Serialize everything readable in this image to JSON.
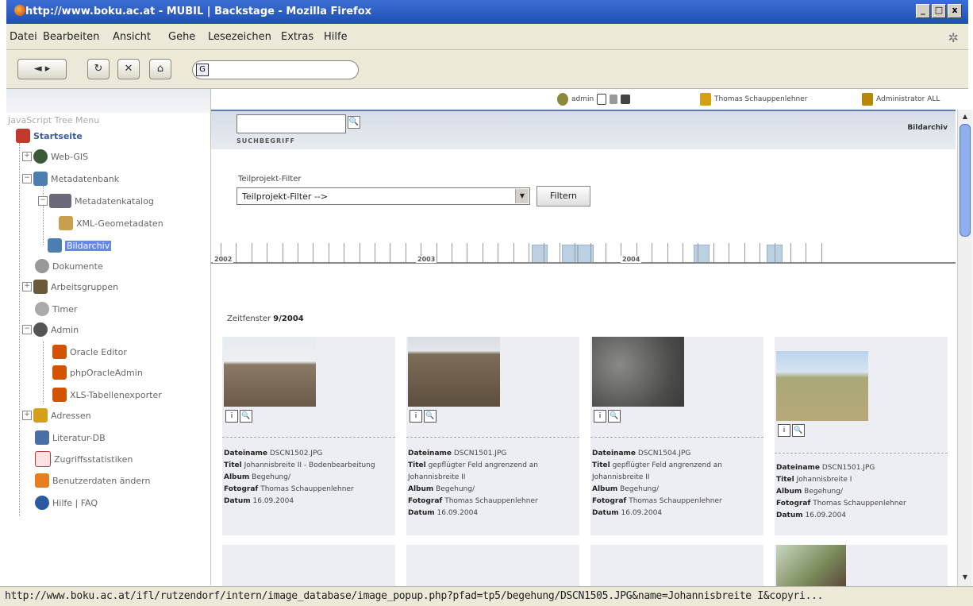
{
  "window": {
    "title": "http://www.boku.ac.at - MUBIL | Backstage - Mozilla Firefox",
    "controls": [
      "_",
      "□",
      "x"
    ]
  },
  "menu": {
    "items": [
      "Datei",
      "Bearbeiten",
      "Ansicht",
      "Gehe",
      "Lesezeichen",
      "Extras",
      "Hilfe"
    ]
  },
  "nav": {
    "back": "◄ ▸",
    "reload": "↻",
    "stop": "✕",
    "home": "⌂",
    "url_icon": "G"
  },
  "sidebar": {
    "title": "JavaScript Tree Menu",
    "items": [
      {
        "label": "Startseite",
        "icon": "home-icon",
        "color": "#c0392b"
      },
      {
        "label": "Web-GIS",
        "icon": "globe-icon",
        "color": "#3a5a3a"
      },
      {
        "label": "Metadatenbank",
        "icon": "database-icon",
        "color": "#4a7fb0"
      },
      {
        "label": "Metadatenkatalog",
        "icon": "catalog-icon",
        "color": "#6a6a7a"
      },
      {
        "label": "XML-Geometadaten",
        "icon": "xml-icon",
        "color": "#c8a050"
      },
      {
        "label": "Bildarchiv",
        "icon": "archive-icon",
        "color": "#4a7fb0"
      },
      {
        "label": "Dokumente",
        "icon": "documents-icon",
        "color": "#777777"
      },
      {
        "label": "Arbeitsgruppen",
        "icon": "group-icon",
        "color": "#6a5a3a"
      },
      {
        "label": "Timer",
        "icon": "timer-icon",
        "color": "#888888"
      },
      {
        "label": "Admin",
        "icon": "admin-icon",
        "color": "#555555"
      },
      {
        "label": "Oracle Editor",
        "icon": "editor-icon",
        "color": "#d35400"
      },
      {
        "label": "phpOracleAdmin",
        "icon": "oracle-admin-icon",
        "color": "#d35400"
      },
      {
        "label": "XLS-Tabellenexporter",
        "icon": "xls-export-icon",
        "color": "#d35400"
      },
      {
        "label": "Adressen",
        "icon": "address-icon",
        "color": "#d4a017"
      },
      {
        "label": "Literatur-DB",
        "icon": "literature-icon",
        "color": "#4a6fa5"
      },
      {
        "label": "Zugriffsstatistiken",
        "icon": "stats-icon",
        "color": "#c0392b"
      },
      {
        "label": "Benutzerdaten ändern",
        "icon": "user-edit-icon",
        "color": "#e67e22"
      },
      {
        "label": "Hilfe | FAQ",
        "icon": "help-icon",
        "color": "#2c5aa0"
      }
    ]
  },
  "header": {
    "admin_label": "admin",
    "user_label": "Thomas Schauppenlehner",
    "role_label": "Administrator ALL"
  },
  "search": {
    "label": "SUCHBEGRIFF",
    "go": "🔍",
    "section_title": "Bildarchiv"
  },
  "filter": {
    "label": "Teilprojekt-Filter",
    "selected": "Teilprojekt-Filter -->",
    "button": "Filtern"
  },
  "timeline": {
    "years": [
      "2002",
      "2003",
      "2004"
    ]
  },
  "gallery": {
    "window_label": "Zeitfenster",
    "window_value": "9/2004",
    "field_labels": {
      "filename": "Dateiname",
      "title": "Titel",
      "album": "Album",
      "photographer": "Fotograf",
      "date": "Datum"
    },
    "cards": [
      {
        "filename": "DSCN1502.JPG",
        "title": "Johannisbreite II - Bodenbearbeitung",
        "album": "Begehung/",
        "photographer": "Thomas Schauppenlehner",
        "date": "16.09.2004"
      },
      {
        "filename": "DSCN1501.JPG",
        "title": "gepflügter Feld angrenzend an Johannisbreite II",
        "album": "Begehung/",
        "photographer": "Thomas Schauppenlehner",
        "date": "16.09.2004"
      },
      {
        "filename": "DSCN1504.JPG",
        "title": "gepflügter Feld angrenzend an Johannisbreite II",
        "album": "Begehung/",
        "photographer": "Thomas Schauppenlehner",
        "date": "16.09.2004"
      },
      {
        "filename": "DSCN1501.JPG",
        "title": "Johannisbreite I",
        "album": "Begehung/",
        "photographer": "Thomas Schauppenlehner",
        "date": "16.09.2004"
      }
    ],
    "info_icon": "i",
    "zoom_icon": "🔍"
  },
  "status": {
    "text": "http://www.boku.ac.at/ifl/rutzendorf/intern/image_database/image_popup.php?pfad=tp5/begehung/DSCN1505.JPG&name=Johannisbreite I&copyri..."
  }
}
